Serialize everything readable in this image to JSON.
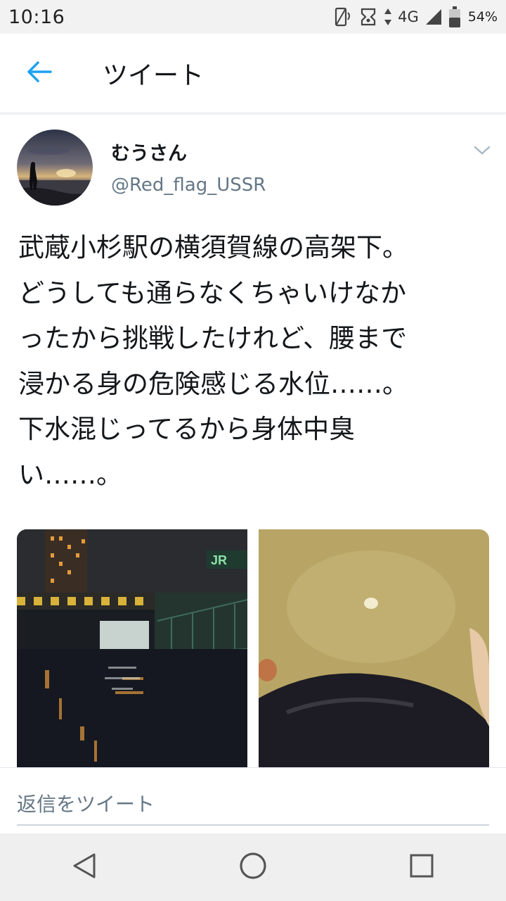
{
  "status_bar": {
    "time": "10:16",
    "network": "4G",
    "battery": "54%"
  },
  "header": {
    "title": "ツイート"
  },
  "tweet": {
    "display_name": "むうさん",
    "username": "@Red_flag_USSR",
    "text": "武蔵小杉駅の横須賀線の高架下。\nどうしても通らなくちゃいけなか\nったから挑戦したけれど、腰まで\n浸かる身の危険感じる水位……。\n下水混じってるから身体中臭\nい……。",
    "photos": [
      "flooded-underpass",
      "muddy-water"
    ]
  },
  "reply": {
    "placeholder": "返信をツイート"
  },
  "colors": {
    "accent": "#1da1f2",
    "text": "#14171a",
    "secondary": "#657786"
  },
  "icons": [
    "back-arrow-icon",
    "chevron-down-icon",
    "nav-back-icon",
    "nav-home-icon",
    "nav-recents-icon"
  ]
}
